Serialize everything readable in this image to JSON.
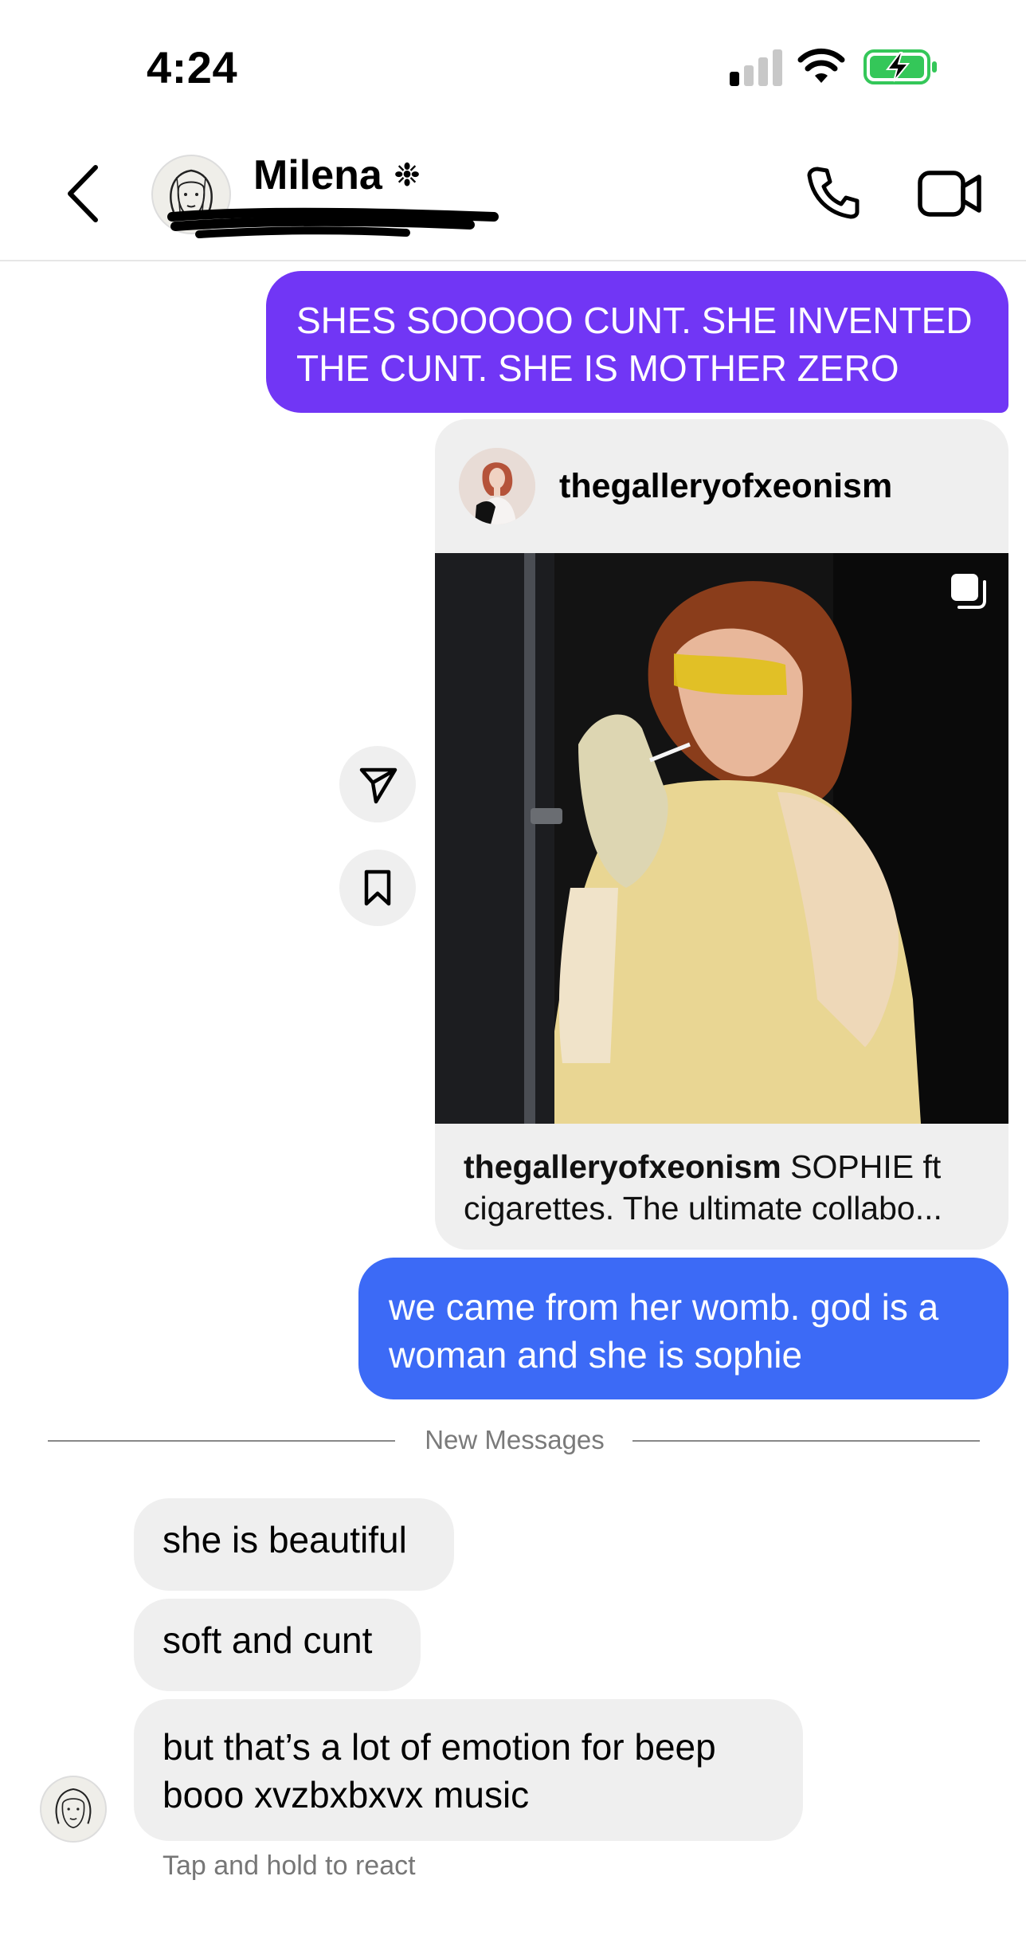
{
  "status_bar": {
    "time": "4:24"
  },
  "header": {
    "contact_name": "Milena",
    "name_badge": "❉"
  },
  "messages": {
    "outgoing_1": "SHES SOOOOO CUNT. SHE INVENTED THE CUNT. SHE IS MOTHER ZERO",
    "shared_post": {
      "username": "thegalleryofxeonism",
      "caption_user": "thegalleryofxeonism",
      "caption_text": " SOPHIE ft cigarettes. The ultimate collabo..."
    },
    "outgoing_2": "we came from her womb. god is a woman and she is sophie",
    "divider_label": "New Messages",
    "incoming": [
      "she is beautiful",
      "soft and cunt",
      "but that’s a lot of emotion for beep booo xvzbxbxvx music"
    ],
    "react_hint": "Tap and hold to react"
  },
  "colors": {
    "purple_bubble": "#7136f5",
    "blue_bubble": "#3c6af6",
    "grey_bubble": "#efefef",
    "battery_green": "#34c759"
  },
  "icons": [
    "back-chevron-icon",
    "phone-icon",
    "video-camera-icon",
    "share-send-icon",
    "bookmark-icon",
    "carousel-icon"
  ]
}
